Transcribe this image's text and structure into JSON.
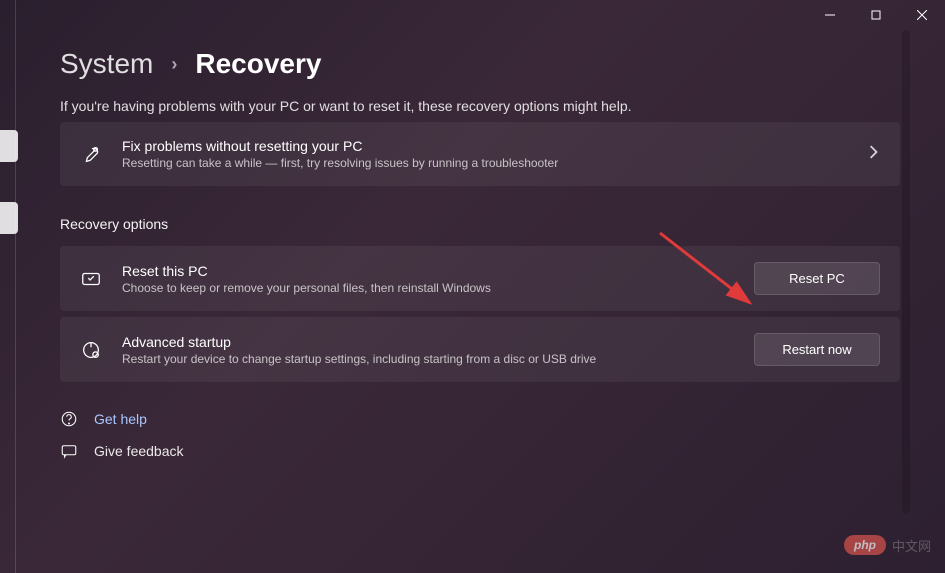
{
  "breadcrumb": {
    "parent": "System",
    "current": "Recovery"
  },
  "subtitle": "If you're having problems with your PC or want to reset it, these recovery options might help.",
  "troubleshoot": {
    "title": "Fix problems without resetting your PC",
    "desc": "Resetting can take a while — first, try resolving issues by running a troubleshooter"
  },
  "section_header": "Recovery options",
  "reset": {
    "title": "Reset this PC",
    "desc": "Choose to keep or remove your personal files, then reinstall Windows",
    "button": "Reset PC"
  },
  "advanced": {
    "title": "Advanced startup",
    "desc": "Restart your device to change startup settings, including starting from a disc or USB drive",
    "button": "Restart now"
  },
  "links": {
    "help": "Get help",
    "feedback": "Give feedback"
  },
  "watermark": {
    "badge": "php",
    "text": "中文网"
  }
}
